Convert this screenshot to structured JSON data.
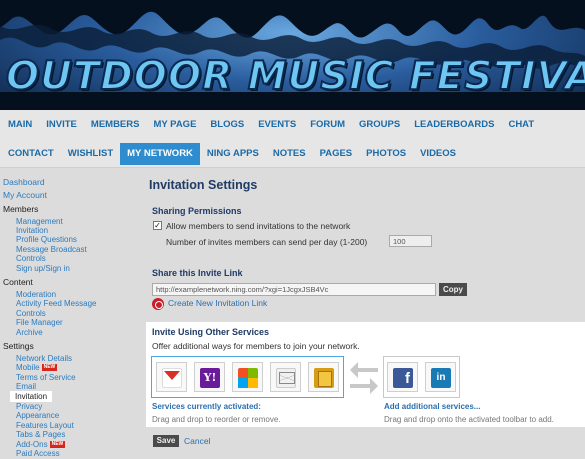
{
  "banner": {
    "title": "OUTDOOR MUSIC FESTIVALS"
  },
  "nav": {
    "row1": [
      "MAIN",
      "INVITE",
      "MEMBERS",
      "MY PAGE",
      "BLOGS",
      "EVENTS",
      "FORUM",
      "GROUPS",
      "LEADERBOARDS",
      "CHAT"
    ],
    "row2": [
      "CONTACT",
      "WISHLIST",
      "MY NETWORK",
      "NING APPS",
      "NOTES",
      "PAGES",
      "PHOTOS",
      "VIDEOS"
    ],
    "active": "MY NETWORK"
  },
  "sidebar": {
    "dashboard": "Dashboard",
    "my_account": "My Account",
    "members_head": "Members",
    "members_items": [
      "Management",
      "Invitation",
      "Profile Questions",
      "Message Broadcast",
      "Controls",
      "Sign up/Sign in"
    ],
    "content_head": "Content",
    "content_items": [
      "Moderation",
      "Activity Feed Message",
      "Controls",
      "File Manager",
      "Archive"
    ],
    "settings_head": "Settings",
    "settings_items": [
      "Network Details",
      "Mobile",
      "Terms of Service",
      "Email",
      "Invitation",
      "Privacy",
      "Appearance",
      "Features Layout",
      "Tabs & Pages",
      "Add-Ons",
      "Paid Access"
    ],
    "new_badge": "NEW",
    "selected": "Invitation"
  },
  "main": {
    "title": "Invitation Settings",
    "sharing": {
      "heading": "Sharing Permissions",
      "allow_label": "Allow members to send invitations to the network",
      "allow_checked": true,
      "limit_label": "Number of invites members can send per day (1-200)",
      "limit_value": "100"
    },
    "invite_link": {
      "heading": "Share this Invite Link",
      "url": "http://examplenetwork.ning.com/?xgi=1JcgxJSB4Vc",
      "copy_label": "Copy",
      "create_label": "Create New Invitation Link"
    },
    "services": {
      "heading": "Invite Using Other Services",
      "description": "Offer additional ways for members to join your network.",
      "active": [
        "gmail-icon",
        "yahoo-icon",
        "windows-live-icon",
        "email-icon",
        "address-book-icon"
      ],
      "available": [
        "facebook-icon",
        "linkedin-icon"
      ],
      "yahoo_glyph": "Y!",
      "facebook_glyph": "f",
      "linkedin_glyph": "in",
      "active_label": "Services currently activated:",
      "active_hint": "Drag and drop to reorder or remove.",
      "add_label": "Add additional services...",
      "add_hint": "Drag and drop onto the activated toolbar to add."
    },
    "save_label": "Save",
    "cancel_label": "Cancel"
  }
}
